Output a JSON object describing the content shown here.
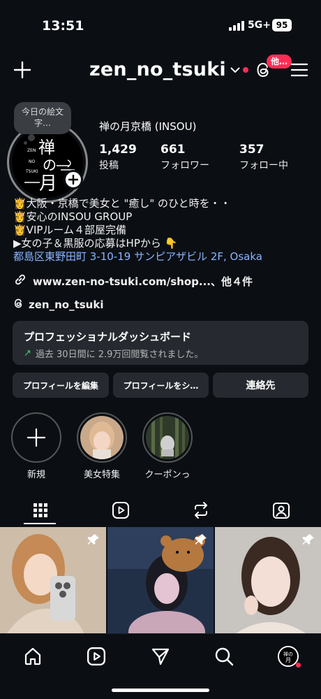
{
  "status_bar": {
    "time": "13:51",
    "network": "5G+",
    "battery": "95"
  },
  "header": {
    "username": "zen_no_tsuki",
    "threads_badge": "他…",
    "icons": [
      "plus-icon",
      "chevron-down-icon",
      "threads-icon",
      "menu-icon"
    ]
  },
  "note": {
    "text": "今日の絵文字…"
  },
  "avatar": {
    "logo_text": [
      "禅",
      "の",
      "月"
    ],
    "logo_small": [
      "ZEN",
      "NO",
      "TSUKI"
    ]
  },
  "profile": {
    "display_name": "禅の月京橋 (INSOU)",
    "stats": [
      {
        "value": "1,429",
        "label": "投稿"
      },
      {
        "value": "661",
        "label": "フォロワー"
      },
      {
        "value": "357",
        "label": "フォロー中"
      }
    ],
    "bio": [
      "👸大阪・京橋で美女と \"癒し\" のひと時を・・",
      "👸安心のINSOU GROUP",
      "👸VIPルーム４部屋完備",
      "▶女の子＆黒服の応募はHPから 👇"
    ],
    "address": "都島区東野田町 3-10-19 サンピアザビル 2F, Osaka",
    "link": "www.zen-no-tsuki.com/shop...、他４件",
    "threads_handle": "zen_no_tsuki"
  },
  "dashboard": {
    "title": "プロフェッショナルダッシュボード",
    "subtitle": "過去 30日間に 2.9万回閲覧されました。"
  },
  "buttons": {
    "edit": "プロフィールを編集",
    "share": "プロフィールをシ…",
    "contact": "連絡先"
  },
  "highlights": [
    {
      "label": "新規"
    },
    {
      "label": "美女特集"
    },
    {
      "label": "クーポンっ"
    }
  ],
  "tabs": [
    "grid-icon",
    "reels-icon",
    "reposts-icon",
    "tagged-icon"
  ],
  "bottom_nav": [
    "home-icon",
    "reels-icon",
    "send-icon",
    "search-icon",
    "profile-avatar"
  ],
  "colors": {
    "background": "#0b0f14",
    "card": "#262a30",
    "accent_red": "#ff2d55",
    "link_blue": "#8ab4ff",
    "growth_green": "#2bd97a"
  }
}
